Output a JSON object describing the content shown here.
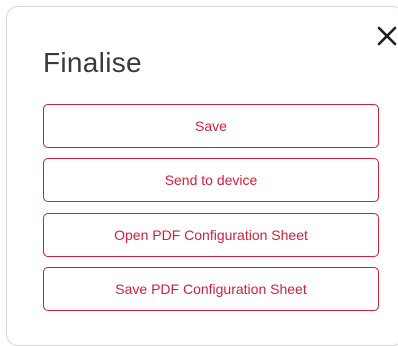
{
  "dialog": {
    "title": "Finalise",
    "accent_color": "#d21f3c",
    "close_icon": "close-icon",
    "buttons": [
      {
        "label": "Save"
      },
      {
        "label": "Send to device"
      },
      {
        "label": "Open PDF Configuration Sheet"
      },
      {
        "label": "Save PDF Configuration Sheet"
      }
    ]
  }
}
